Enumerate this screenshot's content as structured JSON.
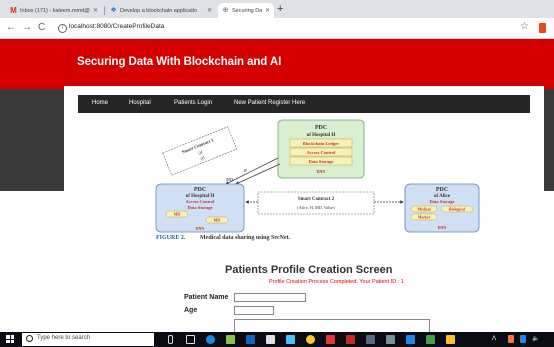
{
  "browser": {
    "tabs": [
      {
        "title": "Inbox (171) - kaleem.mmd@gm",
        "icon": "gmail-icon",
        "active": false
      },
      {
        "title": "Develop a blockchain applicatio",
        "icon": "blockchain-icon",
        "active": false
      },
      {
        "title": "Securing Data With Blockchain a",
        "icon": "globe-icon",
        "active": true
      }
    ],
    "new_tab": "+",
    "address": "localhost:8080/CreateProfileData"
  },
  "site": {
    "title": "Securing Data With Blockchain and AI",
    "nav": [
      "Home",
      "Hospital",
      "Patients Login",
      "New Patient Register Here"
    ]
  },
  "figure": {
    "pdc_a": {
      "title": "PDC",
      "subtitle": "of Hospital H",
      "sub": "A",
      "rows": [
        "Blockchain Ledger",
        "Access Control",
        "Data Storage"
      ],
      "footer": "DNN"
    },
    "pdc_b": {
      "title": "PDC",
      "subtitle": "of Hospital H",
      "sub": "B",
      "rows": [
        "Access Control",
        "Data Storage"
      ],
      "pills": [
        "MD",
        "MD"
      ],
      "footer": "DNN"
    },
    "pdc_c": {
      "title": "PDC",
      "subtitle": "of Alice",
      "rows": [
        "Data Storage"
      ],
      "pills": [
        "Medical",
        "Biological",
        "Market"
      ],
      "footer": "DNN"
    },
    "contract1": {
      "title": "Smart Contract 1",
      "line1": "(H",
      "line2": "(H"
    },
    "contract2": {
      "title": "Smart Contract 2",
      "line": "(Alice, H, MD, Value)"
    },
    "arrow_label_top": "R",
    "arrow_label_mid": "MD",
    "caption_label": "FIGURE 2.",
    "caption_text": "Medical data sharing using SecNet."
  },
  "form": {
    "title": "Patients Profile Creation Screen",
    "message": "Profile Creation Process Completed. Your Patient ID : 1",
    "fields": [
      {
        "label": "Patient Name",
        "value": ""
      },
      {
        "label": "Age",
        "value": ""
      }
    ]
  },
  "taskbar": {
    "search_placeholder": "Type here to search"
  },
  "colors": {
    "header_red": "#d40000",
    "dark_band": "#3a3a3a",
    "navbar": "#262626",
    "pdc_green": "#d8efd0",
    "pdc_blue": "#cfe0f5",
    "message_red": "#e00000"
  }
}
